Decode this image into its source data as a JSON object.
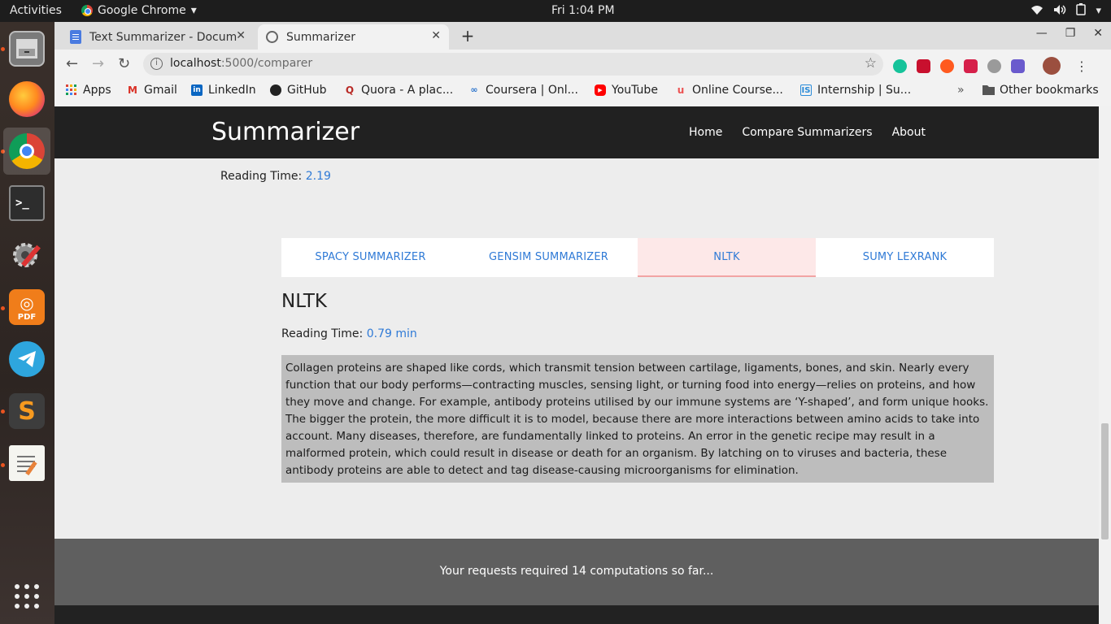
{
  "system": {
    "activities": "Activities",
    "app_name": "Google Chrome",
    "clock": "Fri  1:04 PM"
  },
  "browser": {
    "tabs": [
      {
        "title": "Text Summarizer - Docum"
      },
      {
        "title": "Summarizer"
      }
    ],
    "url_host": "localhost",
    "url_path": ":5000/comparer",
    "bookmarks": [
      "Apps",
      "Gmail",
      "LinkedIn",
      "GitHub",
      "Quora - A plac...",
      "Coursera | Onl...",
      "YouTube",
      "Online Course...",
      "Internship | Su...",
      "»",
      "Other bookmarks"
    ]
  },
  "page": {
    "brand": "Summarizer",
    "nav": [
      "Home",
      "Compare Summarizers",
      "About"
    ],
    "top_reading_label": "Reading Time:",
    "top_reading_value": "2.19",
    "tabs": [
      "SPACY SUMMARIZER",
      "GENSIM SUMMARIZER",
      "NLTK",
      "SUMY LEXRANK"
    ],
    "active_tab": "NLTK",
    "section_title": "NLTK",
    "reading_label": "Reading Time:",
    "reading_value": "0.79 min",
    "summary": "Collagen proteins are shaped like cords, which transmit tension between cartilage, ligaments, bones, and skin. Nearly every function that our body performs—contracting muscles, sensing light, or turning food into energy—relies on proteins, and how they move and change. For example, antibody proteins utilised by our immune systems are ‘Y-shaped’, and form unique hooks. The bigger the protein, the more difficult it is to model, because there are more interactions between amino acids to take into account. Many diseases, therefore, are fundamentally linked to proteins. An error in the genetic recipe may result in a malformed protein, which could result in disease or death for an organism. By latching on to viruses and bacteria, these antibody proteins are able to detect and tag disease-causing microorganisms for elimination.",
    "footer": "Your requests required 14 computations so far..."
  }
}
